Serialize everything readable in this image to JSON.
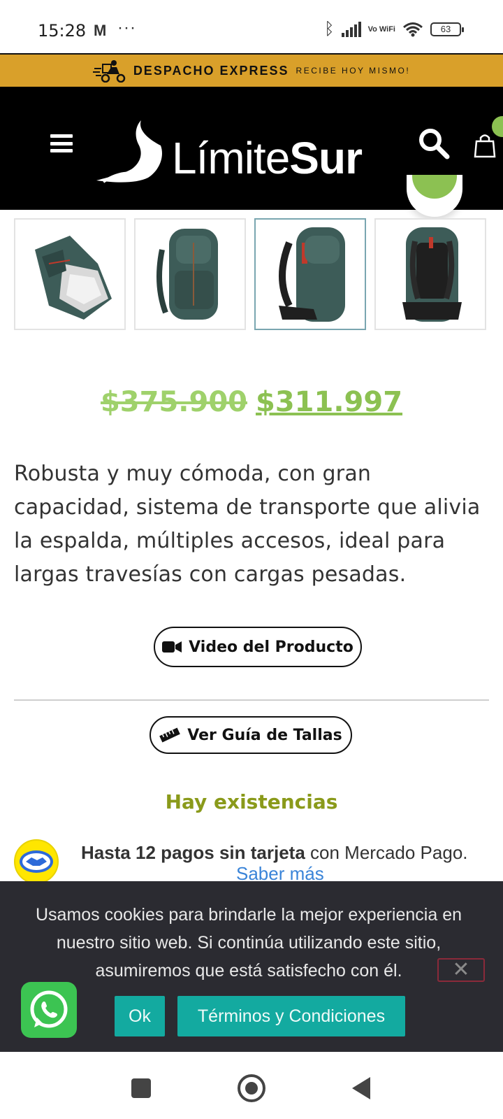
{
  "status_bar": {
    "time": "15:28",
    "vowifi": "Vo WiFi",
    "battery": "63"
  },
  "promo": {
    "title": "DESPACHO EXPRESS",
    "subtitle": "RECIBE HOY MISMO!",
    "icon": "delivery-scooter-icon"
  },
  "header": {
    "logo_light": "Límite",
    "logo_bold": "Sur",
    "icons": [
      "menu-icon",
      "search-icon",
      "cart-icon"
    ]
  },
  "gallery": {
    "thumbnails": [
      "backpack-open",
      "backpack-front",
      "backpack-side",
      "backpack-back"
    ],
    "selected_index": 2
  },
  "product": {
    "price_old": "$375.900",
    "price_new": "$311.997",
    "description": "Robusta y muy cómoda, con gran capacidad, sistema de transporte que alivia la espalda, múltiples accesos, ideal para largas travesías con cargas pesadas.",
    "video_button": "Video del Producto",
    "size_button": "Ver Guía de Tallas",
    "stock": "Hay existencias"
  },
  "mercado_pago": {
    "bold_text": "Hasta 12 pagos sin tarjeta",
    "text": " con Mercado Pago.",
    "link": "Saber más"
  },
  "cookie_banner": {
    "message": "Usamos cookies para brindarle la mejor experiencia en nuestro sitio web. Si continúa utilizando este sitio, asumiremos que está satisfecho con él.",
    "ok_label": "Ok",
    "terms_label": "Términos y Condiciones",
    "close_glyph": "✕"
  },
  "colors": {
    "promo_bg": "#d9a02a",
    "price_green": "#8cc152",
    "stock_olive": "#8a9a1a",
    "cookie_button": "#13aaa0",
    "whatsapp_green": "#3cc452"
  }
}
